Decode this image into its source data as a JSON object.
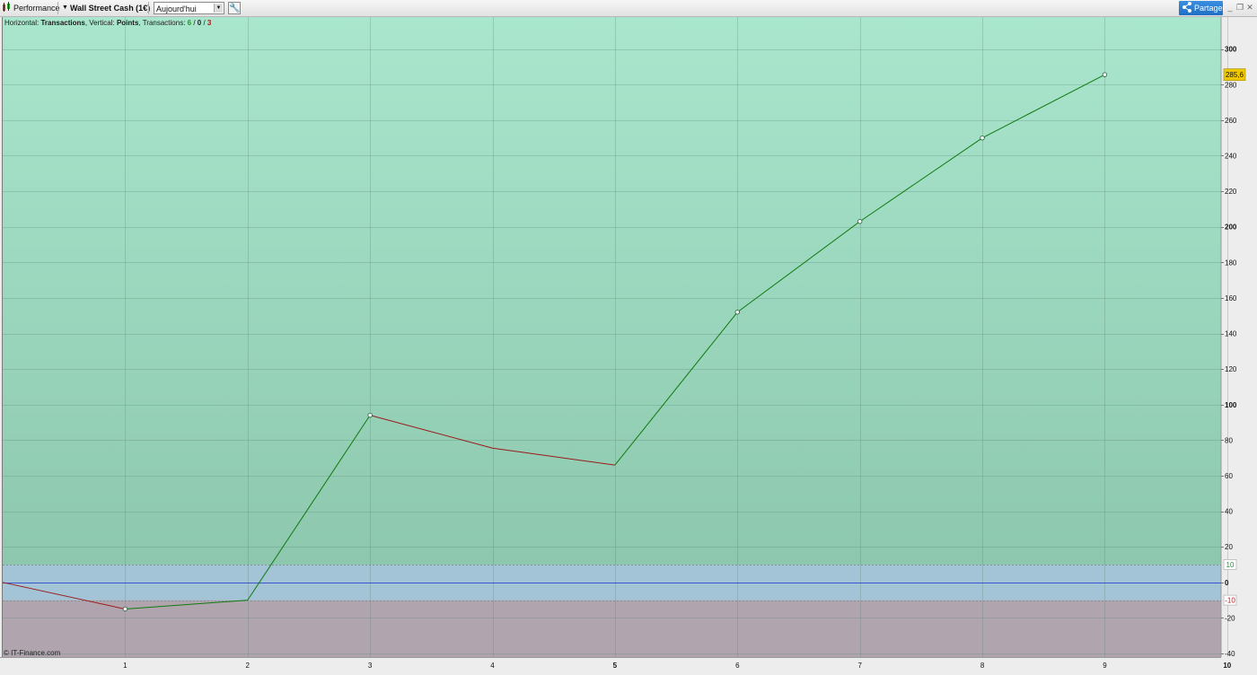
{
  "toolbar": {
    "panel_label": "Performance",
    "instrument_label": "Wall Street Cash (1€)",
    "period_value": "Aujourd'hui",
    "share_label": "Partager"
  },
  "info": {
    "prefix_h": "Horizontal: ",
    "h_value": "Transactions",
    "prefix_v": ", Vertical: ",
    "v_value": "Points",
    "prefix_t": ", Transactions: ",
    "t_wins": "6",
    "t_slash1": " / ",
    "t_neutral": "0",
    "t_slash2": " / ",
    "t_losses": "3"
  },
  "copyright": "© IT-Finance.com",
  "colors": {
    "win_line": "#0f7a0f",
    "loss_line": "#9b1a1a",
    "zero_line": "#3a55d0",
    "last_value_badge": "#f0c800"
  },
  "chart_data": {
    "type": "line",
    "x": [
      0,
      1,
      2,
      3,
      4,
      5,
      6,
      7,
      8,
      9
    ],
    "y": [
      0,
      -15,
      -10,
      94,
      75.5,
      66,
      152,
      203,
      250,
      285.6
    ],
    "point_markers": [
      1,
      3,
      6,
      7,
      8,
      9
    ],
    "segment_colors": [
      "loss",
      "win",
      "win",
      "loss",
      "loss",
      "win",
      "win",
      "win",
      "win"
    ],
    "xlim": [
      0,
      9.95
    ],
    "ylim": [
      -42,
      318
    ],
    "x_ticks": [
      "1",
      "2",
      "3",
      "4",
      "5",
      "6",
      "7",
      "8",
      "9",
      "10"
    ],
    "x_ticks_bold": [
      "5",
      "10"
    ],
    "y_ticks": [
      -40,
      -20,
      0,
      20,
      40,
      60,
      80,
      100,
      120,
      140,
      160,
      180,
      200,
      220,
      240,
      260,
      280,
      300
    ],
    "y_ticks_bold": [
      0,
      100,
      200,
      300
    ],
    "neutral_band": [
      -10,
      10
    ],
    "band_labels": [
      "10",
      "-10"
    ],
    "last_value_label": "285,6",
    "grid": true
  }
}
